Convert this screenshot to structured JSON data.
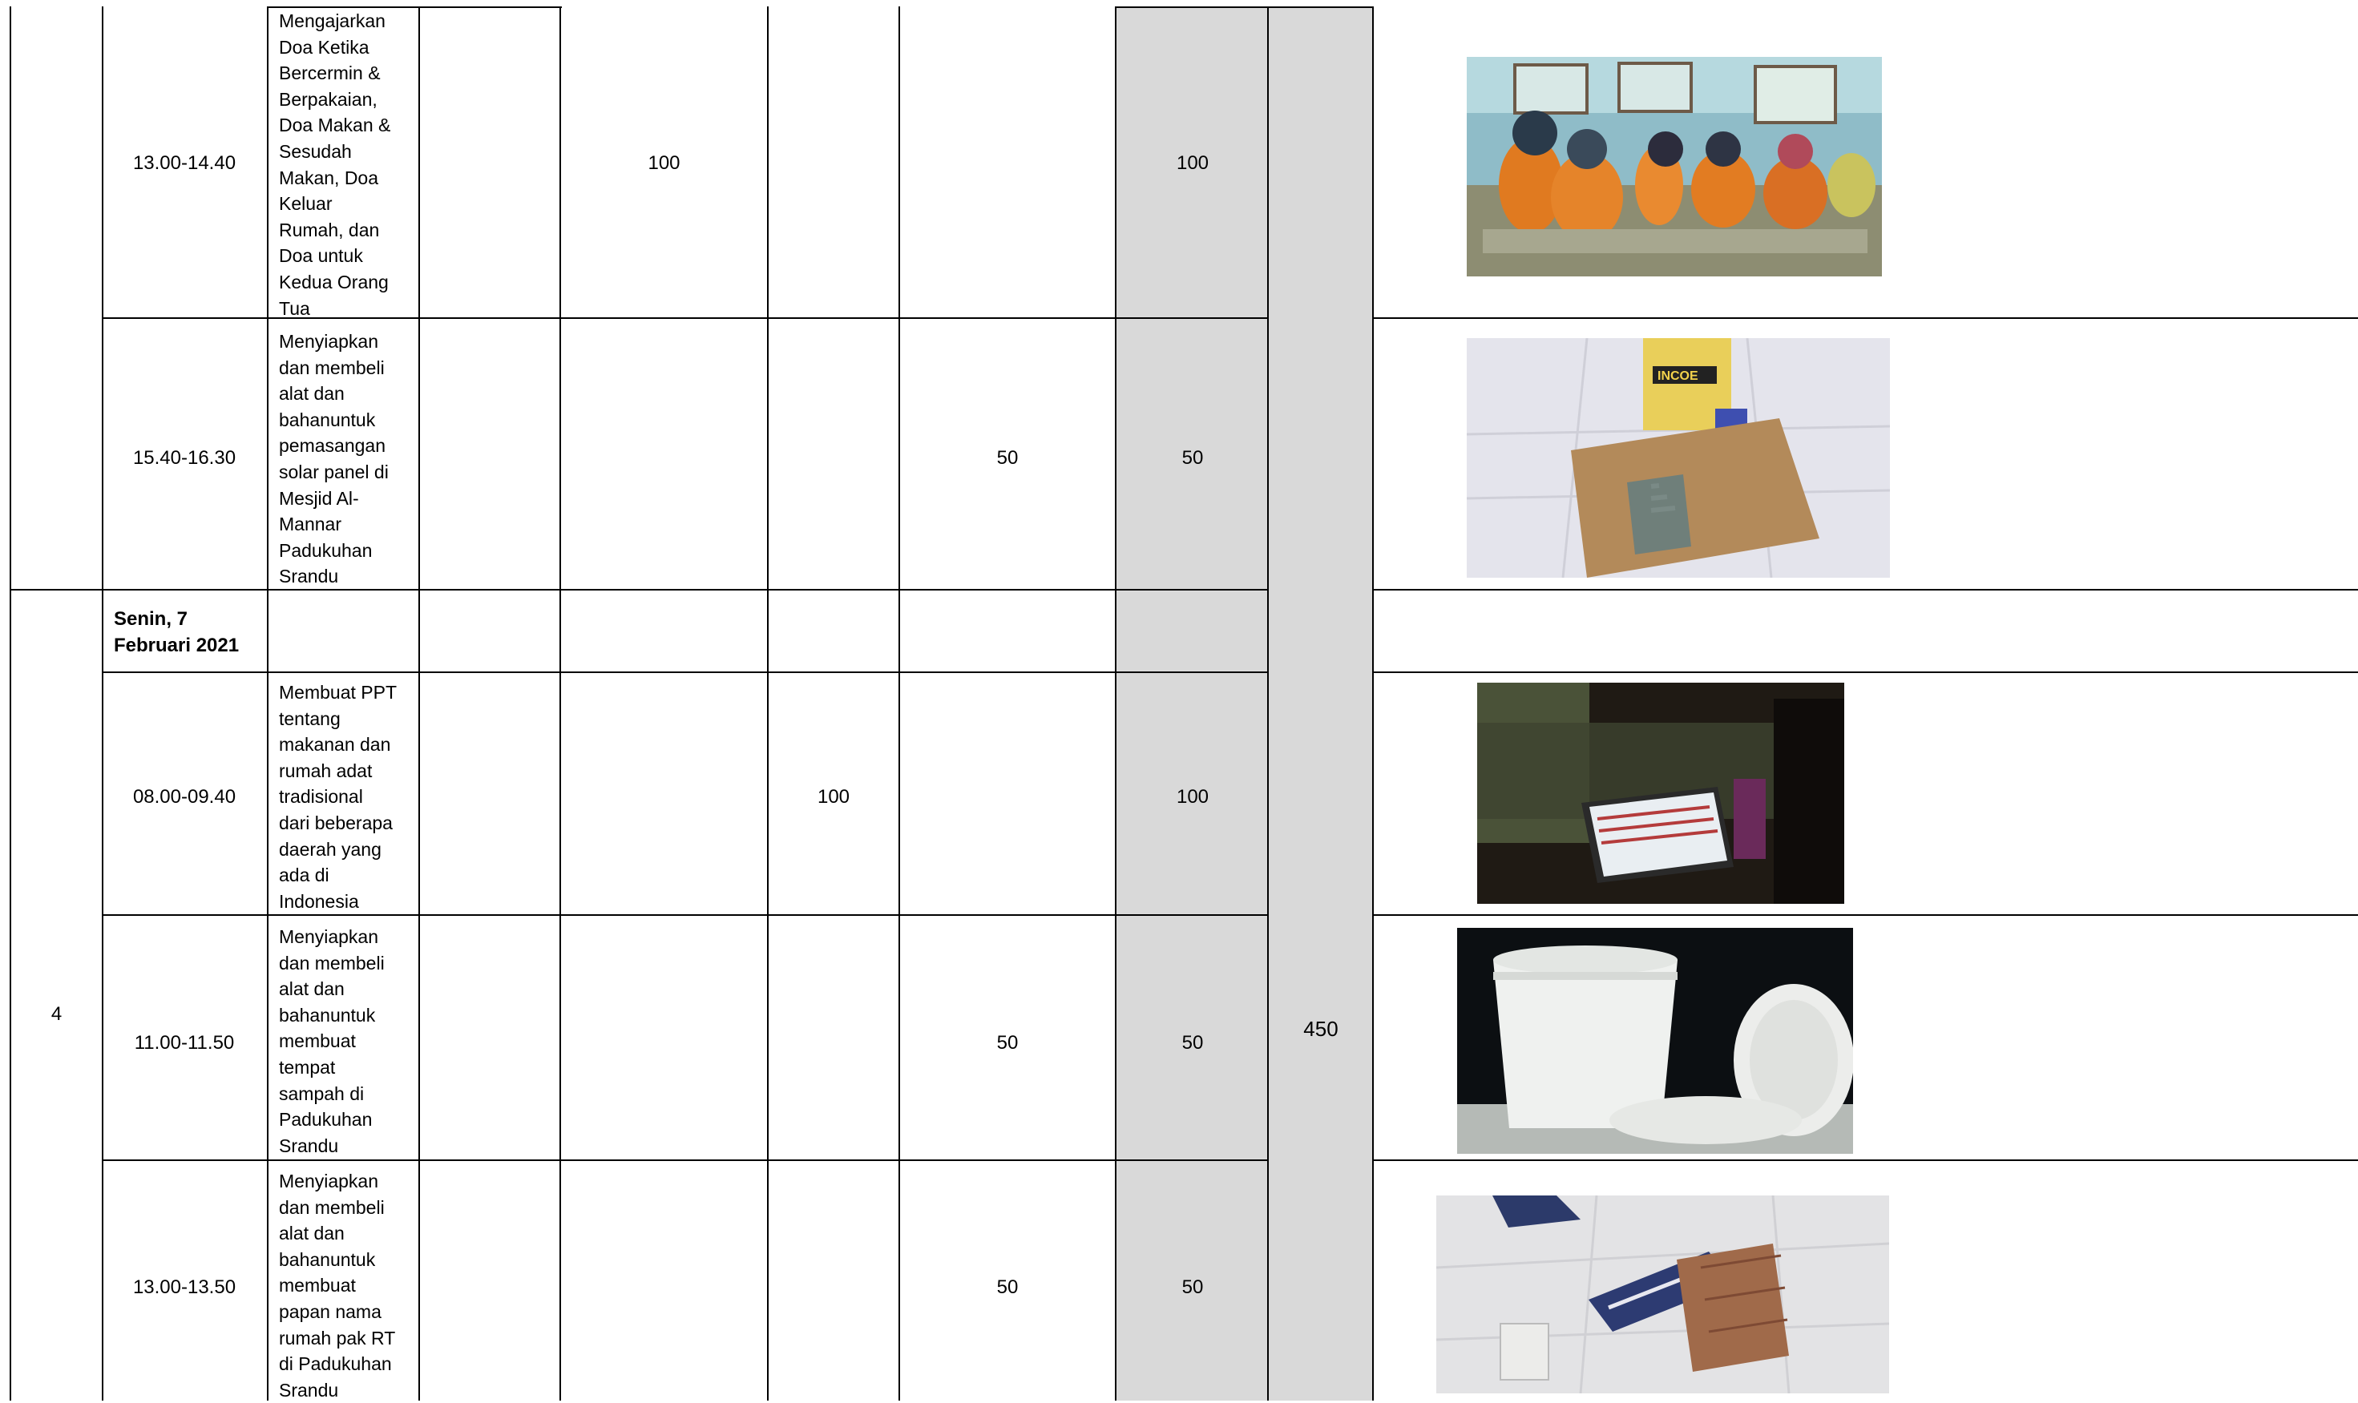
{
  "rows": [
    {
      "time": "13.00-14.40",
      "activity": "Mengajarkan\nDoa Ketika\nBercermin &\nBerpakaian,\nDoa Makan &\nSesudah\nMakan, Doa\nKeluar\nRumah, dan\nDoa untuk\nKedua Orang\nTua",
      "value_a": "100",
      "value_b": "",
      "value_c": "",
      "subtotal": "100",
      "photo": "photo-students-praying"
    },
    {
      "time": "15.40-16.30",
      "activity": "Menyiapkan\ndan membeli\nalat dan\nbahanuntuk\npemasangan\nsolar panel di\nMesjid Al-\nMannar\nPadukuhan\nSrandu",
      "value_a": "",
      "value_b": "",
      "value_c": "50",
      "subtotal": "50",
      "photo": "photo-solar-panel-box"
    },
    {
      "day_number": "4",
      "date": "Senin, 7\nFebruari 2021"
    },
    {
      "time": "08.00-09.40",
      "activity": "Membuat PPT\ntentang\nmakanan dan\nrumah adat\ntradisional\ndari beberapa\ndaerah yang\nada di\nIndonesia",
      "value_a": "",
      "value_b": "100",
      "value_c": "",
      "subtotal": "100",
      "photo": "photo-laptop-ppt"
    },
    {
      "time": "11.00-11.50",
      "activity": "Menyiapkan\ndan membeli\nalat dan\nbahanuntuk\nmembuat\ntempat\nsampah di\nPadukuhan\nSrandu",
      "value_a": "",
      "value_b": "",
      "value_c": "50",
      "subtotal": "50",
      "photo": "photo-buckets"
    },
    {
      "time": "13.00-13.50",
      "activity": "Menyiapkan\ndan membeli\nalat dan\nbahanuntuk\nmembuat\npapan nama\nrumah pak RT\ndi Padukuhan\nSrandu",
      "value_a": "",
      "value_b": "",
      "value_c": "50",
      "subtotal": "50",
      "photo": "photo-name-board"
    }
  ],
  "total": "450"
}
